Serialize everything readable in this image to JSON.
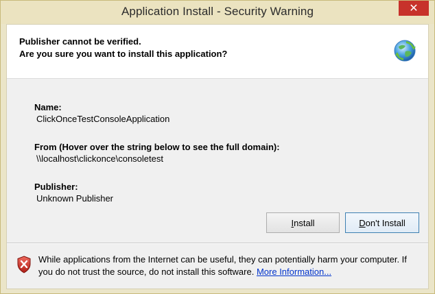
{
  "window": {
    "title": "Application Install - Security Warning",
    "close_label": "✕"
  },
  "banner": {
    "line1": "Publisher cannot be verified.",
    "line2": "Are you sure you want to install this application?",
    "icon": "globe-install-icon"
  },
  "details": {
    "name_label": "Name:",
    "name_value": "ClickOnceTestConsoleApplication",
    "from_label": "From (Hover over the string below to see the full domain):",
    "from_value": "\\\\localhost\\clickonce\\consoletest",
    "publisher_label": "Publisher:",
    "publisher_value": "Unknown Publisher"
  },
  "buttons": {
    "install_first": "I",
    "install_rest": "nstall",
    "dont_first": "D",
    "dont_rest": "on't Install"
  },
  "warning": {
    "icon": "shield-x-icon",
    "text": "While applications from the Internet can be useful, they can potentially harm your computer. If you do not trust the source, do not install this software.",
    "link": "More Information..."
  },
  "colors": {
    "close_button": "#c7322b",
    "titlebar": "#ebe3c0",
    "link": "#0033cc",
    "default_button_border": "#3c7fb1"
  }
}
